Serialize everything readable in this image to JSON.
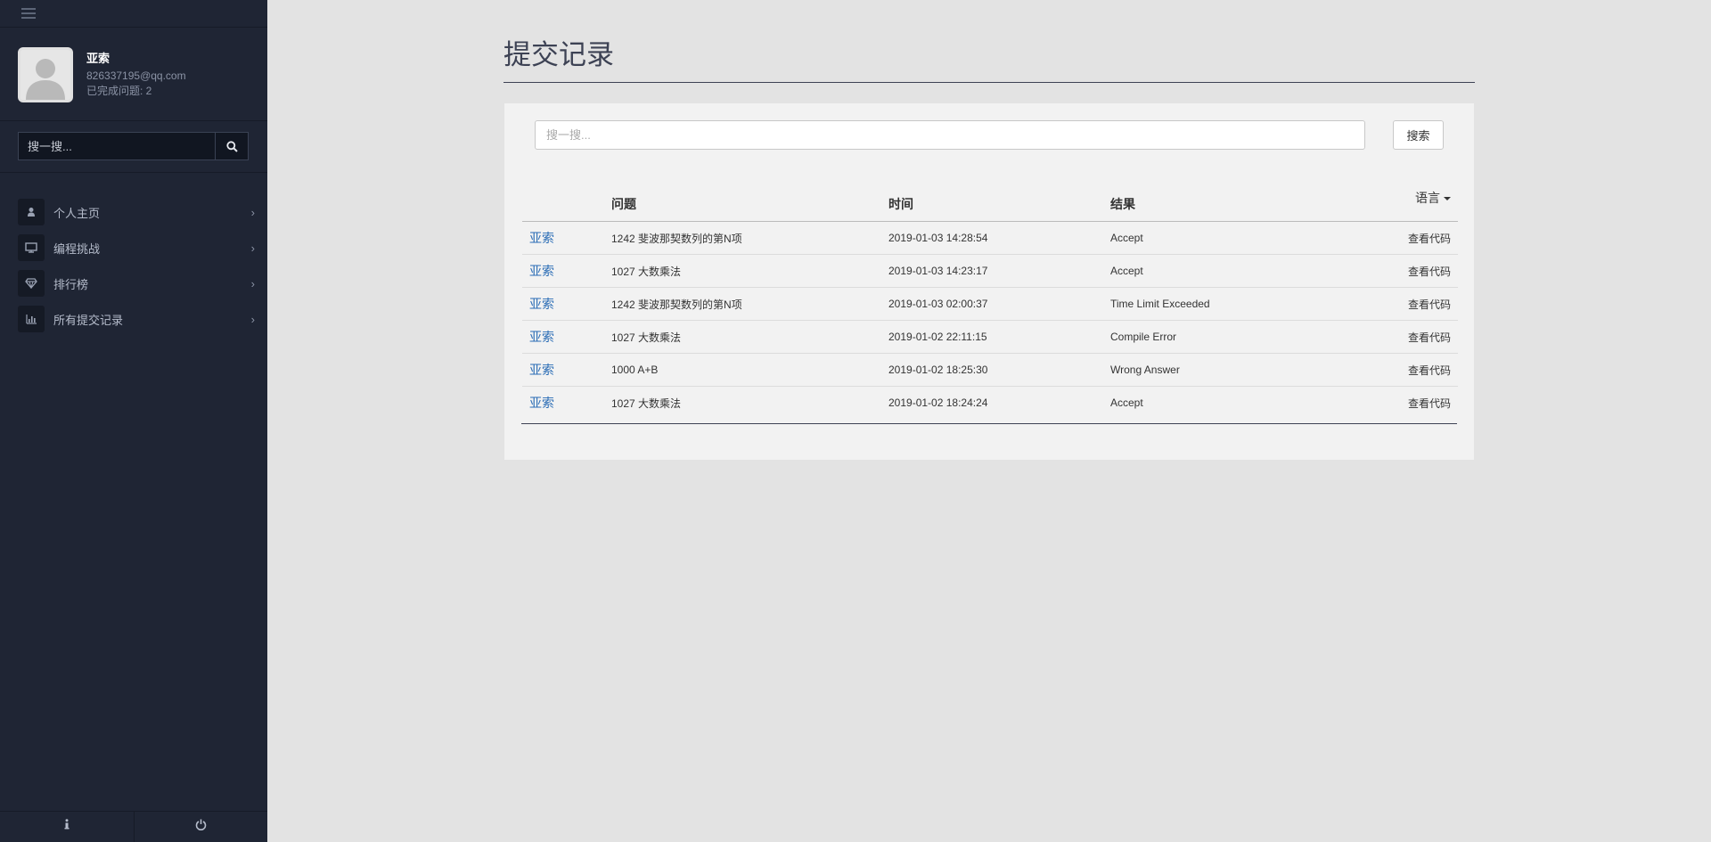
{
  "sidebar": {
    "profile": {
      "name": "亚索",
      "email": "826337195@qq.com",
      "solved": "已完成问题: 2"
    },
    "search_placeholder": "搜一搜...",
    "nav": [
      {
        "label": "个人主页",
        "icon": "user-icon"
      },
      {
        "label": "编程挑战",
        "icon": "monitor-icon"
      },
      {
        "label": "排行榜",
        "icon": "diamond-icon"
      },
      {
        "label": "所有提交记录",
        "icon": "bar-chart-icon"
      }
    ],
    "chevron": "›",
    "footer": [
      {
        "icon": "info-icon"
      },
      {
        "icon": "power-icon"
      }
    ]
  },
  "page": {
    "title": "提交记录",
    "search_placeholder": "搜一搜...",
    "search_button": "搜索"
  },
  "table": {
    "headers": {
      "user": "",
      "problem": "问题",
      "time": "时间",
      "result": "结果",
      "language": "语言"
    },
    "rows": [
      {
        "user": "亚索",
        "problem": "1242 斐波那契数列的第N项",
        "time": "2019-01-03 14:28:54",
        "result": "Accept",
        "action": "查看代码"
      },
      {
        "user": "亚索",
        "problem": "1027 大数乘法",
        "time": "2019-01-03 14:23:17",
        "result": "Accept",
        "action": "查看代码"
      },
      {
        "user": "亚索",
        "problem": "1242 斐波那契数列的第N项",
        "time": "2019-01-03 02:00:37",
        "result": "Time Limit Exceeded",
        "action": "查看代码"
      },
      {
        "user": "亚索",
        "problem": "1027 大数乘法",
        "time": "2019-01-02 22:11:15",
        "result": "Compile Error",
        "action": "查看代码"
      },
      {
        "user": "亚索",
        "problem": "1000 A+B",
        "time": "2019-01-02 18:25:30",
        "result": "Wrong Answer",
        "action": "查看代码"
      },
      {
        "user": "亚索",
        "problem": "1027 大数乘法",
        "time": "2019-01-02 18:24:24",
        "result": "Accept",
        "action": "查看代码"
      }
    ]
  },
  "colors": {
    "sidebar_bg": "#1f2534",
    "page_bg": "#e3e3e3",
    "link": "#2a6cb5",
    "title": "#3d4254"
  }
}
